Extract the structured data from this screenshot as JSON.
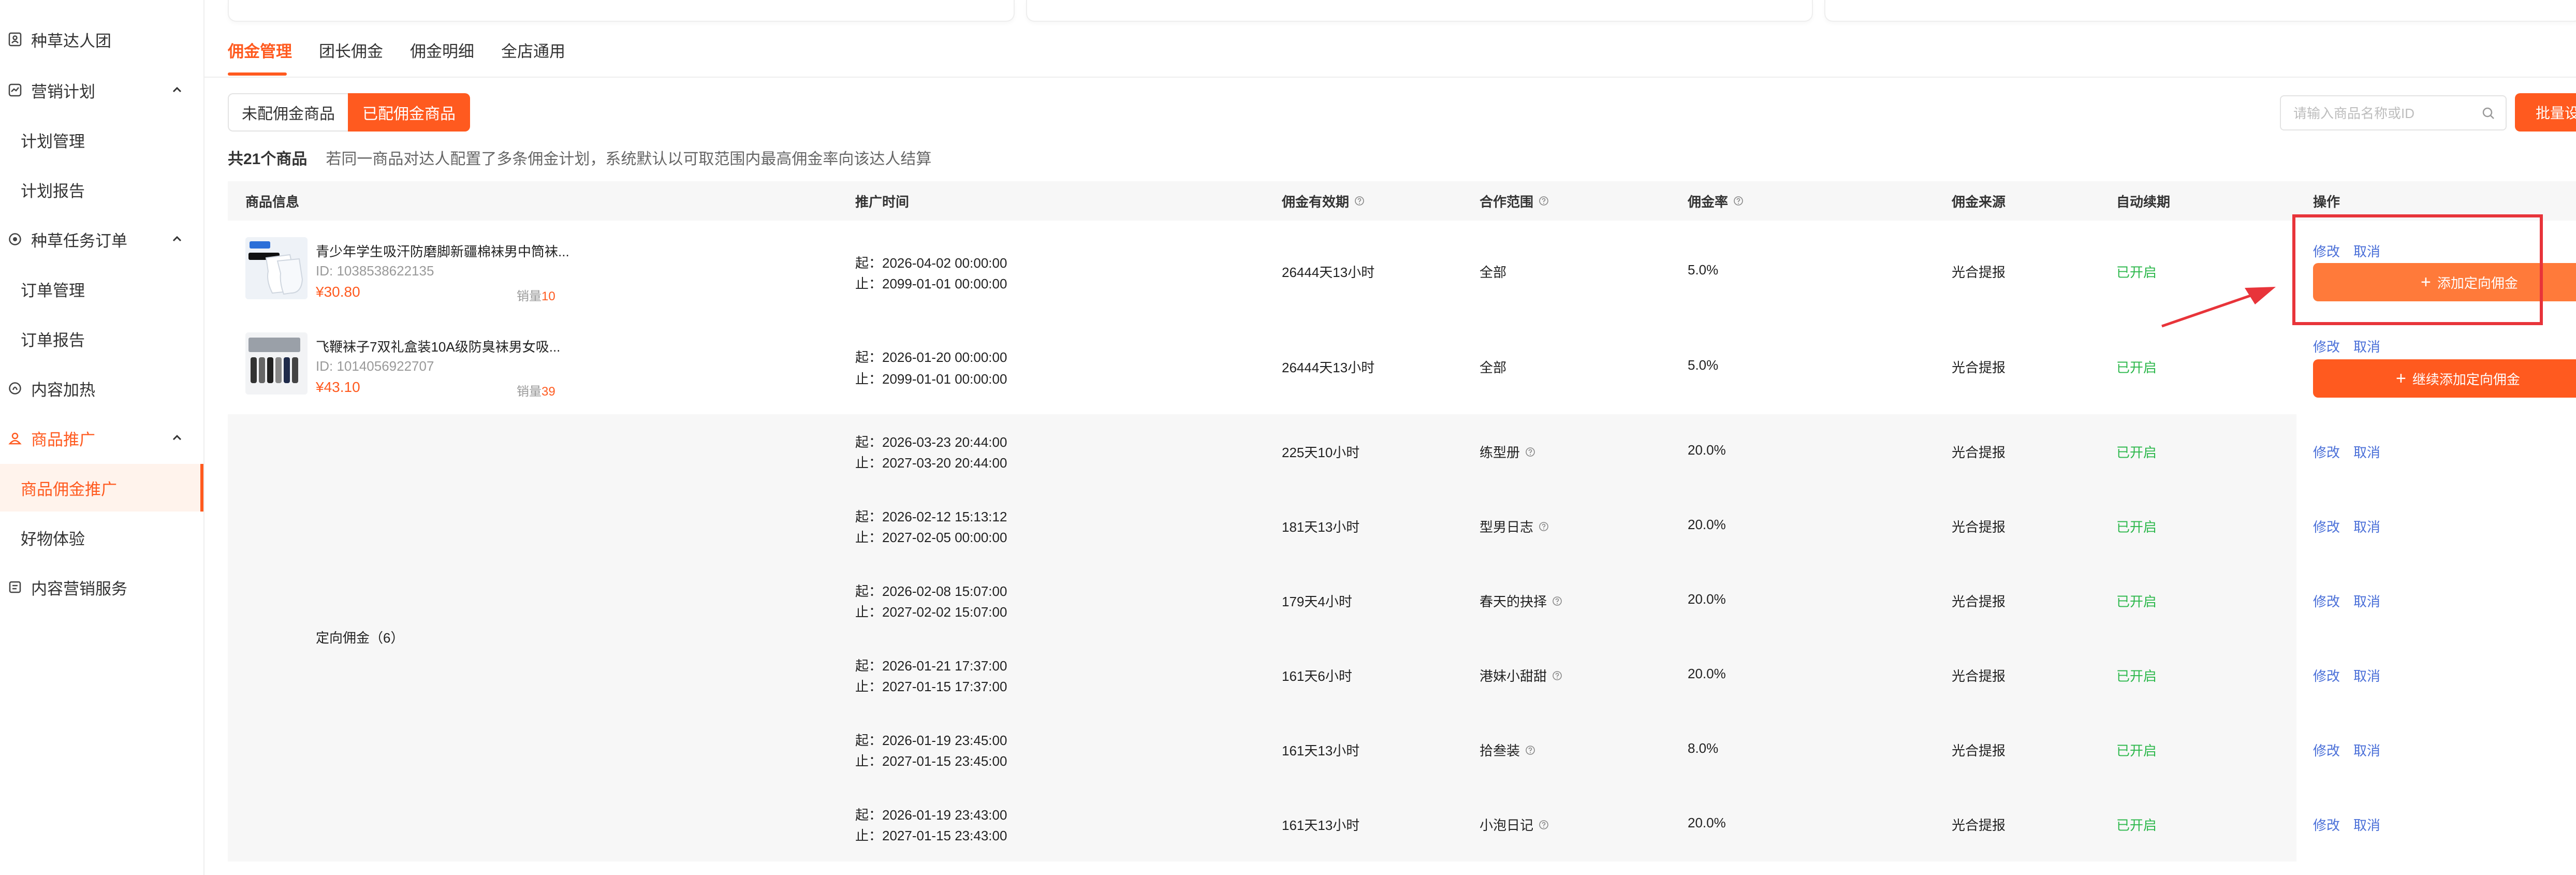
{
  "sidebar": {
    "items": [
      {
        "label": "种草达人团",
        "icon": "user-card-icon"
      },
      {
        "label": "营销计划",
        "icon": "chart-icon"
      },
      {
        "label": "计划管理"
      },
      {
        "label": "计划报告"
      },
      {
        "label": "种草任务订单",
        "icon": "target-icon"
      },
      {
        "label": "订单管理"
      },
      {
        "label": "订单报告"
      },
      {
        "label": "内容加热",
        "icon": "flame-icon"
      },
      {
        "label": "商品推广",
        "icon": "user-icon"
      },
      {
        "label": "商品佣金推广"
      },
      {
        "label": "好物体验"
      },
      {
        "label": "内容营销服务",
        "icon": "document-icon"
      }
    ]
  },
  "tabs": [
    "佣金管理",
    "团长佣金",
    "佣金明细",
    "全店通用"
  ],
  "filter": {
    "unassigned": "未配佣金商品",
    "assigned": "已配佣金商品"
  },
  "search": {
    "placeholder": "请输入商品名称或ID"
  },
  "batch_button": "批量设置",
  "summary": {
    "count_text": "共21个商品",
    "hint": "若同一商品对达人配置了多条佣金计划，系统默认以可取范围内最高佣金率向该达人结算"
  },
  "columns": [
    "商品信息",
    "推广时间",
    "佣金有效期",
    "合作范围",
    "佣金率",
    "佣金来源",
    "自动续期",
    "操作"
  ],
  "products": [
    {
      "title": "青少年学生吸汗防磨脚新疆棉袜男中筒袜...",
      "id": "ID: 1038538622135",
      "price": "¥30.80",
      "sales_label": "销量",
      "sales": "10",
      "start": "起：2026-04-02 00:00:00",
      "end": "止：2099-01-01 00:00:00",
      "validity": "26444天13小时",
      "scope": "全部",
      "rate": "5.0%",
      "source": "光合提报",
      "renew": "已开启",
      "edit": "修改",
      "cancel": "取消",
      "action_button": "添加定向佣金"
    },
    {
      "title": "飞鞭袜子7双礼盒装10A级防臭袜男女吸...",
      "id": "ID: 1014056922707",
      "price": "¥43.10",
      "sales_label": "销量",
      "sales": "39",
      "start": "起：2026-01-20 00:00:00",
      "end": "止：2099-01-01 00:00:00",
      "validity": "26444天13小时",
      "scope": "全部",
      "rate": "5.0%",
      "source": "光合提报",
      "renew": "已开启",
      "edit": "修改",
      "cancel": "取消",
      "action_button": "继续添加定向佣金"
    }
  ],
  "directed_label": "定向佣金（6）",
  "directed": [
    {
      "start": "起：2026-03-23 20:44:00",
      "end": "止：2027-03-20 20:44:00",
      "validity": "225天10小时",
      "scope": "练型册",
      "rate": "20.0%",
      "source": "光合提报",
      "renew": "已开启",
      "edit": "修改",
      "cancel": "取消"
    },
    {
      "start": "起：2026-02-12 15:13:12",
      "end": "止：2027-02-05 00:00:00",
      "validity": "181天13小时",
      "scope": "型男日志",
      "rate": "20.0%",
      "source": "光合提报",
      "renew": "已开启",
      "edit": "修改",
      "cancel": "取消"
    },
    {
      "start": "起：2026-02-08 15:07:00",
      "end": "止：2027-02-02 15:07:00",
      "validity": "179天4小时",
      "scope": "春天的抉择",
      "rate": "20.0%",
      "source": "光合提报",
      "renew": "已开启",
      "edit": "修改",
      "cancel": "取消"
    },
    {
      "start": "起：2026-01-21 17:37:00",
      "end": "止：2027-01-15 17:37:00",
      "validity": "161天6小时",
      "scope": "港妹小甜甜",
      "rate": "20.0%",
      "source": "光合提报",
      "renew": "已开启",
      "edit": "修改",
      "cancel": "取消"
    },
    {
      "start": "起：2026-01-19 23:45:00",
      "end": "止：2027-01-15 23:45:00",
      "validity": "161天13小时",
      "scope": "拾叁装",
      "rate": "8.0%",
      "source": "光合提报",
      "renew": "已开启",
      "edit": "修改",
      "cancel": "取消"
    },
    {
      "start": "起：2026-01-19 23:43:00",
      "end": "止：2027-01-15 23:43:00",
      "validity": "161天13小时",
      "scope": "小泡日记",
      "rate": "20.0%",
      "source": "光合提报",
      "renew": "已开启",
      "edit": "修改",
      "cancel": "取消"
    }
  ],
  "colors": {
    "accent": "#ff5a1f",
    "link": "#4a6fd8",
    "green": "#2db84c",
    "annotation": "#e8343a"
  }
}
